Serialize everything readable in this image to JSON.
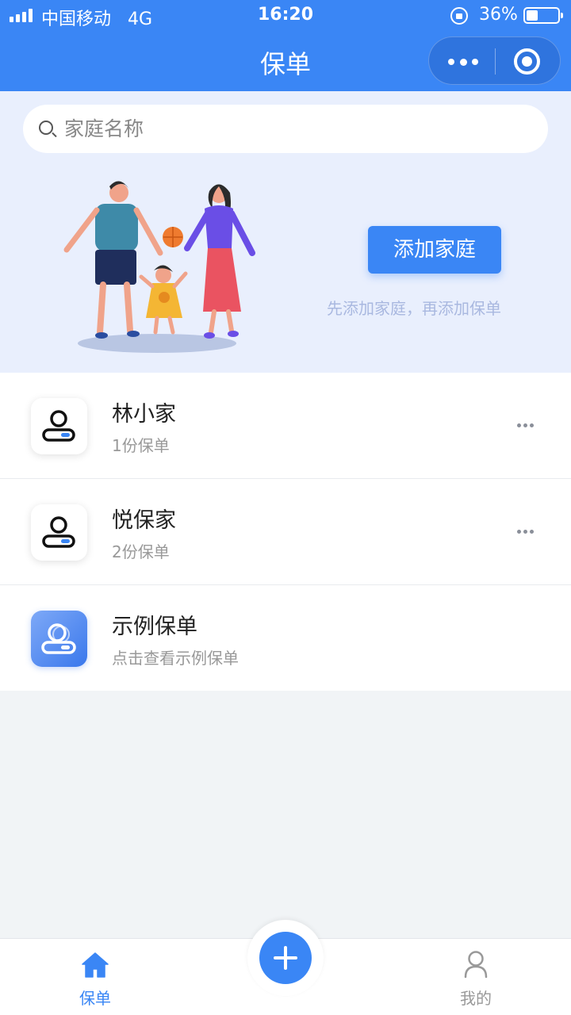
{
  "status_bar": {
    "carrier": "中国移动",
    "network": "4G",
    "time": "16:20",
    "battery_percent_label": "36%",
    "battery_level": 0.36
  },
  "nav": {
    "title": "保单",
    "capsule_icons": [
      "more-dots-icon",
      "target-icon"
    ]
  },
  "search": {
    "placeholder": "家庭名称",
    "value": ""
  },
  "hero": {
    "add_family_label": "添加家庭",
    "hint": "先添加家庭，再添加保单"
  },
  "families": [
    {
      "name": "林小家",
      "subtitle": "1份保单",
      "icon": "family-avatar-icon",
      "has_more": true
    },
    {
      "name": "悦保家",
      "subtitle": "2份保单",
      "icon": "family-avatar-icon",
      "has_more": true
    },
    {
      "name": "示例保单",
      "subtitle": "点击查看示例保单",
      "icon": "sample-policy-icon",
      "has_more": false
    }
  ],
  "tabbar": {
    "home_label": "保单",
    "mine_label": "我的",
    "active_color": "#3a86f5",
    "inactive_color": "#999999"
  },
  "colors": {
    "primary": "#3a86f5",
    "hero_bg": "#e9effd",
    "page_bg": "#f1f4f6"
  }
}
